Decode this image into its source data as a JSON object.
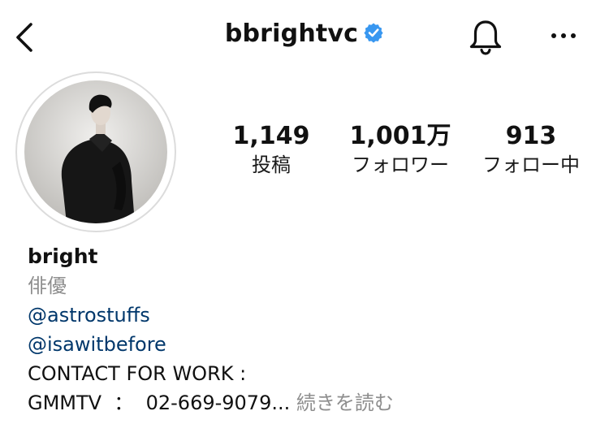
{
  "header": {
    "username": "bbrightvc",
    "verified_color": "#3897f0",
    "back_icon": "chevron-left-icon",
    "bell_icon": "bell-icon",
    "more_icon": "ellipsis-icon"
  },
  "stats": {
    "posts": {
      "value": "1,149",
      "label": "投稿"
    },
    "followers": {
      "value": "1,001万",
      "label": "フォロワー"
    },
    "following": {
      "value": "913",
      "label": "フォロー中"
    }
  },
  "bio": {
    "name": "bright",
    "category": "俳優",
    "mentions": [
      "@astrostuffs",
      "@isawitbefore"
    ],
    "line1": "CONTACT FOR WORK :",
    "line2": "GMMTV  ：  02-669-9079...",
    "more_label": " 続きを読む"
  },
  "colors": {
    "link": "#00376b",
    "muted": "#8e8e8e",
    "ring": "#dcdcdc"
  }
}
